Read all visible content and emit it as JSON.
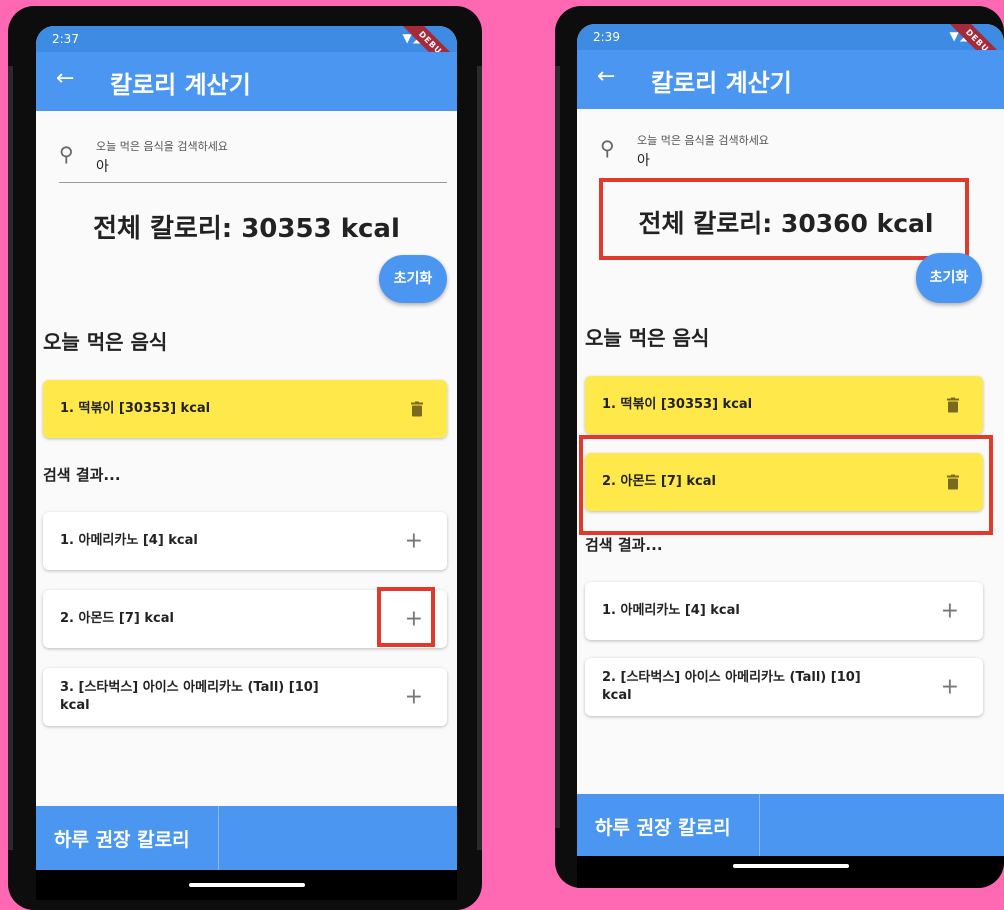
{
  "left": {
    "status_time": "2:37",
    "debug": "DEBUG",
    "title": "칼로리 계산기",
    "search_placeholder": "오늘 먹은 음식을 검색하세요",
    "search_value": "아",
    "total": "전체 칼로리: 30353 kcal",
    "reset_label": "초기화",
    "eaten_heading": "오늘 먹은 음식",
    "eaten": [
      "1. 떡볶이    [30353] kcal"
    ],
    "results_heading": "검색 결과...",
    "results": [
      {
        "line1": "1. 아메리카노    [4] kcal",
        "line2": ""
      },
      {
        "line1": "2. 아몬드    [7] kcal",
        "line2": ""
      },
      {
        "line1": "3. [스타벅스] 아이스 아메리카노 (Tall)    [10]",
        "line2": "kcal"
      }
    ],
    "bottom_label": "하루 권장 칼로리"
  },
  "right": {
    "status_time": "2:39",
    "debug": "DEBUG",
    "title": "칼로리 계산기",
    "search_placeholder": "오늘 먹은 음식을 검색하세요",
    "search_value": "아",
    "total": "전체 칼로리: 30360 kcal",
    "reset_label": "초기화",
    "eaten_heading": "오늘 먹은 음식",
    "eaten": [
      "1. 떡볶이    [30353] kcal",
      "2. 아몬드    [7] kcal"
    ],
    "results_heading": "검색 결과...",
    "results": [
      {
        "line1": "1. 아메리카노    [4] kcal",
        "line2": ""
      },
      {
        "line1": "2. [스타벅스] 아이스 아메리카노 (Tall)    [10]",
        "line2": "kcal"
      }
    ],
    "bottom_label": "하루 권장 칼로리"
  },
  "icons": {
    "back": "arrow-left-icon",
    "search": "search-icon",
    "delete": "trash-icon",
    "add": "plus-icon"
  },
  "colors": {
    "appbar": "#4a96f0",
    "eaten_card": "#ffe94a",
    "highlight": "#e23a2a",
    "background": "#ff69b4"
  }
}
